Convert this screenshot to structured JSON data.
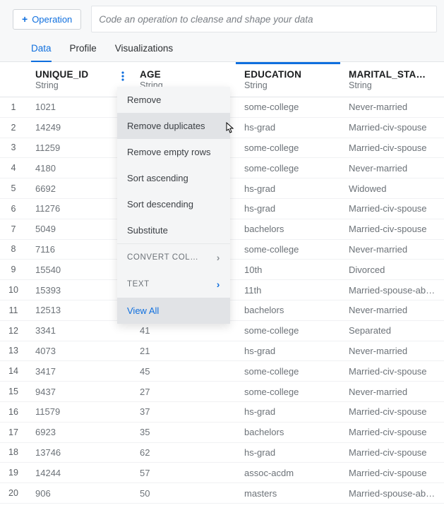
{
  "toolbar": {
    "operation_label": "Operation",
    "placeholder": "Code an operation to cleanse and shape your data"
  },
  "tabs": {
    "items": [
      {
        "label": "Data",
        "active": true
      },
      {
        "label": "Profile",
        "active": false
      },
      {
        "label": "Visualizations",
        "active": false
      }
    ]
  },
  "columns": [
    {
      "name": "UNIQUE_ID",
      "type": "String",
      "selected": false,
      "menu_open": true
    },
    {
      "name": "AGE",
      "type": "String",
      "selected": false,
      "menu_open": false
    },
    {
      "name": "EDUCATION",
      "type": "String",
      "selected": true,
      "menu_open": false
    },
    {
      "name": "MARITAL_STA…",
      "type": "String",
      "selected": false,
      "menu_open": false
    }
  ],
  "menu": {
    "items": [
      {
        "label": "Remove",
        "kind": "item"
      },
      {
        "label": "Remove duplicates",
        "kind": "item",
        "hover": true
      },
      {
        "label": "Remove empty rows",
        "kind": "item"
      },
      {
        "label": "Sort ascending",
        "kind": "item"
      },
      {
        "label": "Sort descending",
        "kind": "item"
      },
      {
        "label": "Substitute",
        "kind": "item"
      },
      {
        "label": "CONVERT COL…",
        "kind": "submenu",
        "chev": "gray"
      },
      {
        "label": "TEXT",
        "kind": "submenu",
        "chev": "blue"
      },
      {
        "label": "View All",
        "kind": "viewall"
      }
    ]
  },
  "rows": [
    {
      "n": "1",
      "unique_id": "1021",
      "age": "",
      "education": "some-college",
      "marital": "Never-married"
    },
    {
      "n": "2",
      "unique_id": "14249",
      "age": "",
      "education": "hs-grad",
      "marital": "Married-civ-spouse"
    },
    {
      "n": "3",
      "unique_id": "11259",
      "age": "",
      "education": "some-college",
      "marital": "Married-civ-spouse"
    },
    {
      "n": "4",
      "unique_id": "4180",
      "age": "",
      "education": "some-college",
      "marital": "Never-married"
    },
    {
      "n": "5",
      "unique_id": "6692",
      "age": "",
      "education": "hs-grad",
      "marital": "Widowed"
    },
    {
      "n": "6",
      "unique_id": "11276",
      "age": "",
      "education": "hs-grad",
      "marital": "Married-civ-spouse"
    },
    {
      "n": "7",
      "unique_id": "5049",
      "age": "",
      "education": "bachelors",
      "marital": "Married-civ-spouse"
    },
    {
      "n": "8",
      "unique_id": "7116",
      "age": "",
      "education": "some-college",
      "marital": "Never-married"
    },
    {
      "n": "9",
      "unique_id": "15540",
      "age": "",
      "education": "10th",
      "marital": "Divorced"
    },
    {
      "n": "10",
      "unique_id": "15393",
      "age": "",
      "education": "11th",
      "marital": "Married-spouse-ab…"
    },
    {
      "n": "11",
      "unique_id": "12513",
      "age": "",
      "education": "bachelors",
      "marital": "Never-married"
    },
    {
      "n": "12",
      "unique_id": "3341",
      "age": "41",
      "education": "some-college",
      "marital": "Separated"
    },
    {
      "n": "13",
      "unique_id": "4073",
      "age": "21",
      "education": "hs-grad",
      "marital": "Never-married"
    },
    {
      "n": "14",
      "unique_id": "3417",
      "age": "45",
      "education": "some-college",
      "marital": "Married-civ-spouse"
    },
    {
      "n": "15",
      "unique_id": "9437",
      "age": "27",
      "education": "some-college",
      "marital": "Never-married"
    },
    {
      "n": "16",
      "unique_id": "11579",
      "age": "37",
      "education": "hs-grad",
      "marital": "Married-civ-spouse"
    },
    {
      "n": "17",
      "unique_id": "6923",
      "age": "35",
      "education": "bachelors",
      "marital": "Married-civ-spouse"
    },
    {
      "n": "18",
      "unique_id": "13746",
      "age": "62",
      "education": "hs-grad",
      "marital": "Married-civ-spouse"
    },
    {
      "n": "19",
      "unique_id": "14244",
      "age": "57",
      "education": "assoc-acdm",
      "marital": "Married-civ-spouse"
    },
    {
      "n": "20",
      "unique_id": "906",
      "age": "50",
      "education": "masters",
      "marital": "Married-spouse-ab…"
    }
  ]
}
